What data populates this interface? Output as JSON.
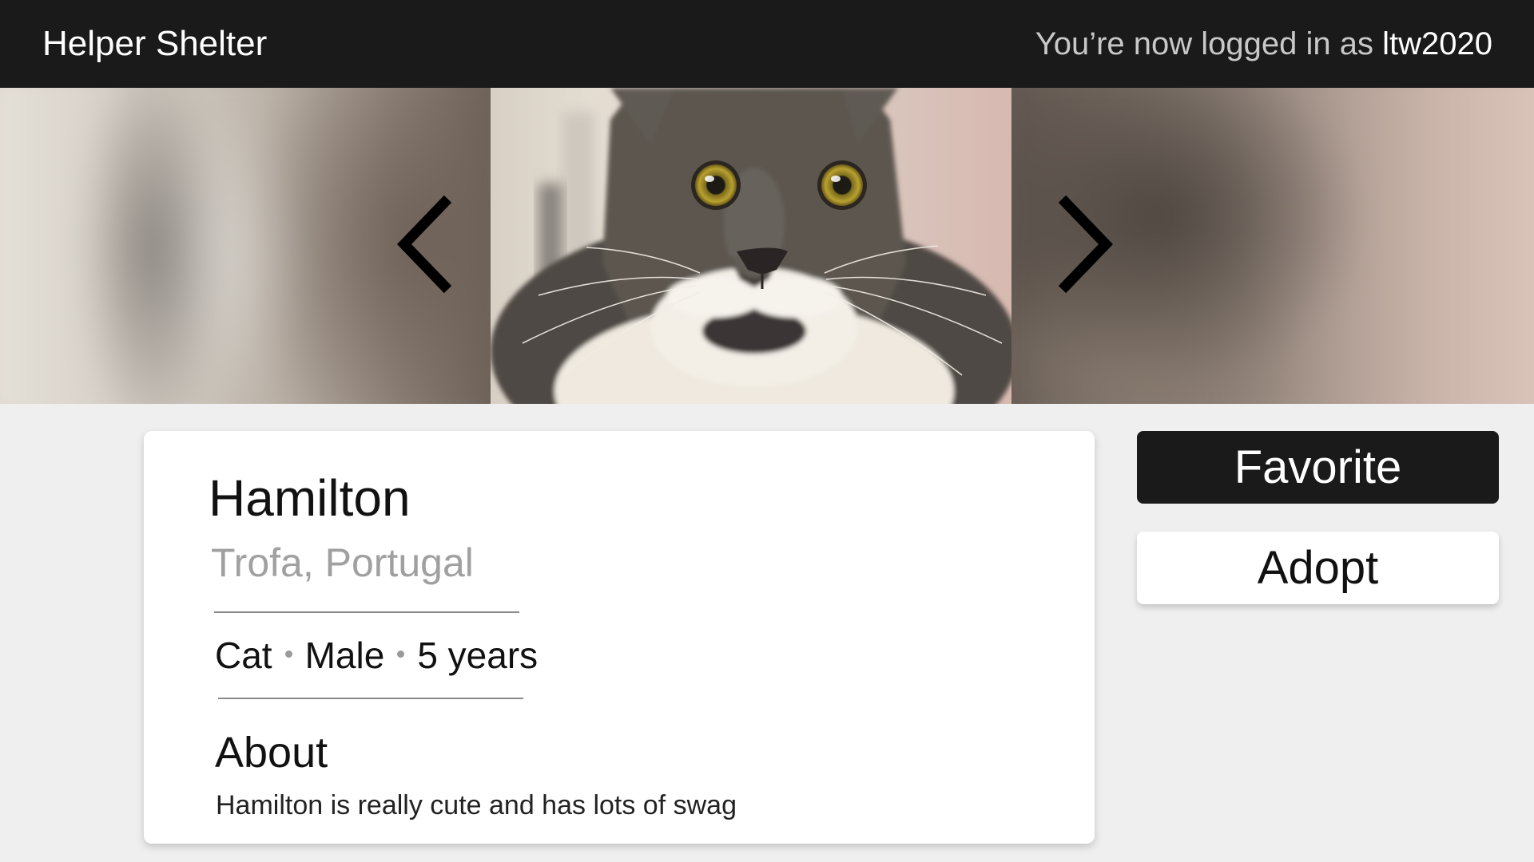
{
  "header": {
    "brand": "Helper Shelter",
    "login_prefix": "You’re now logged in as ",
    "username": "ltw2020"
  },
  "carousel": {
    "prev_icon": "chevron-left-icon",
    "next_icon": "chevron-right-icon",
    "photo": "grey-and-white-cat-photo"
  },
  "pet": {
    "name": "Hamilton",
    "location": "Trofa, Portugal",
    "species": "Cat",
    "sex": "Male",
    "age": "5 years",
    "about_heading": "About",
    "about_text": "Hamilton is really cute and has lots of swag"
  },
  "actions": {
    "favorite_label": "Favorite",
    "adopt_label": "Adopt"
  },
  "colors": {
    "topbar": "#1a1a1a",
    "page_background": "#efefef",
    "muted_text": "#a0a0a0"
  }
}
